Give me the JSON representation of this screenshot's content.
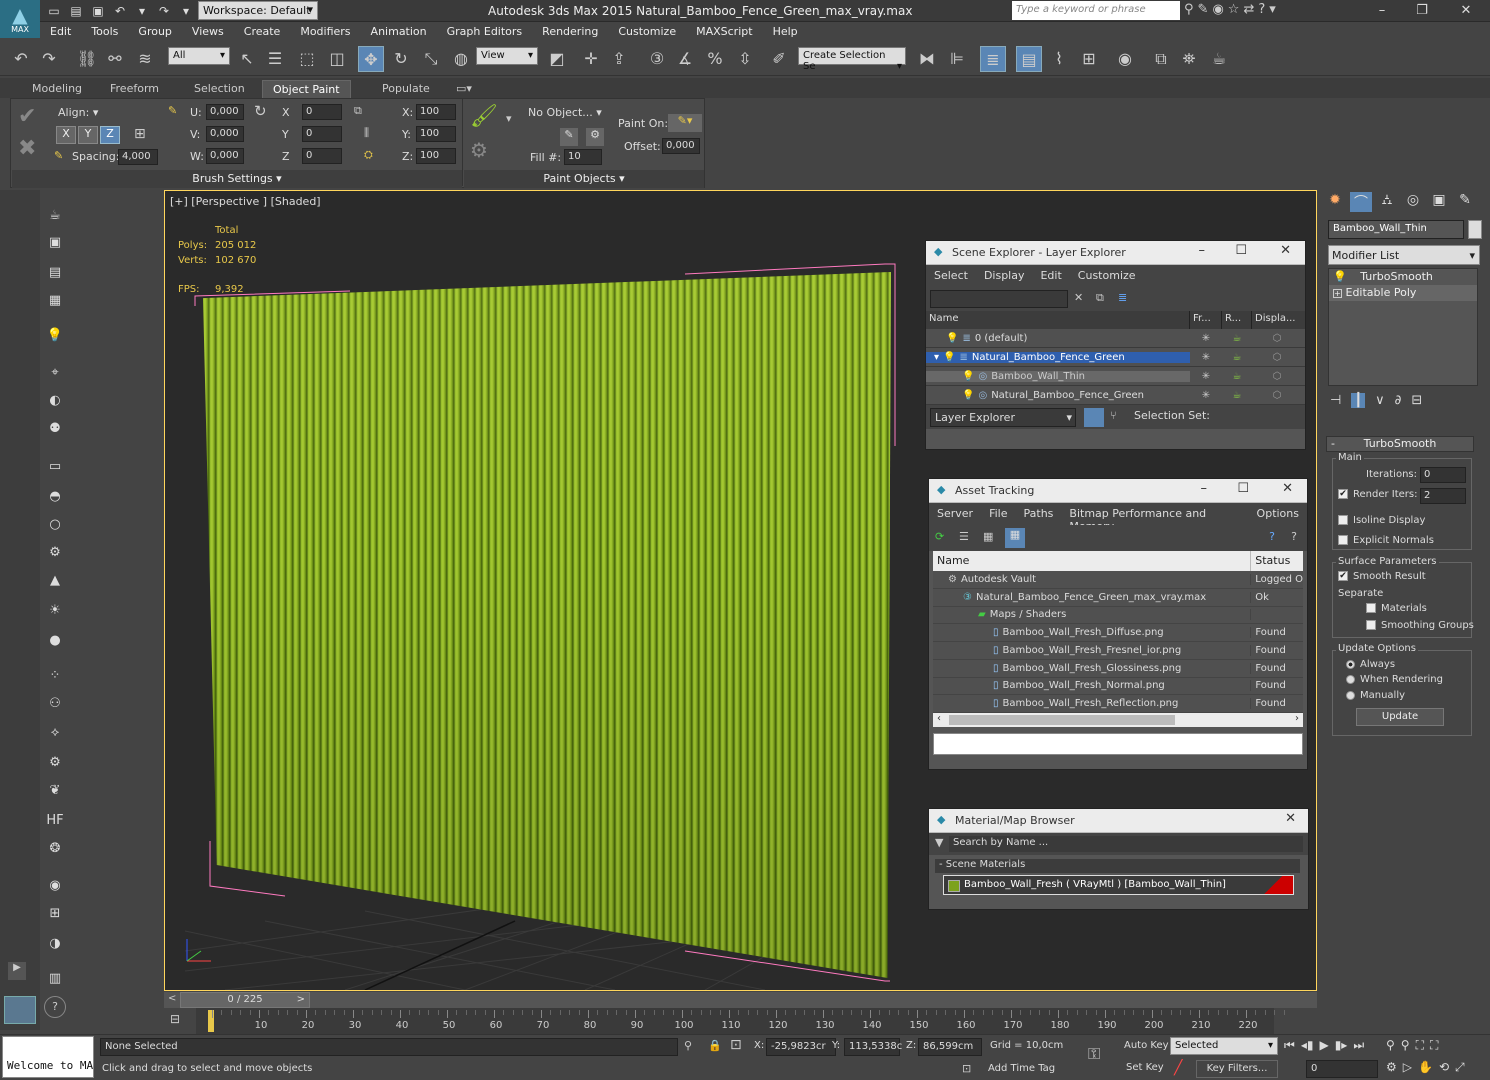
{
  "app": {
    "logo_label": "MAX",
    "workspace": "Workspace: Default",
    "title": "Autodesk 3ds Max  2015    Natural_Bamboo_Fence_Green_max_vray.max",
    "search_placeholder": "Type a keyword or phrase"
  },
  "menu": [
    "Edit",
    "Tools",
    "Group",
    "Views",
    "Create",
    "Modifiers",
    "Animation",
    "Graph Editors",
    "Rendering",
    "Customize",
    "MAXScript",
    "Help"
  ],
  "toolbar": {
    "filter": "All",
    "ref_coord": "View",
    "selection_set": "Create Selection Se"
  },
  "ribbon": {
    "tabs": [
      "Modeling",
      "Freeform",
      "Selection",
      "Object Paint",
      "Populate"
    ],
    "active_tab": "Object Paint",
    "align_label": "Align:",
    "axes": [
      "X",
      "Y",
      "Z"
    ],
    "spacing_label": "Spacing:",
    "spacing_value": "4,000",
    "u_label": "U:",
    "u_value": "0,000",
    "v_label": "V:",
    "v_value": "0,000",
    "w_label": "W:",
    "w_value": "0,000",
    "rx_label": "X",
    "rx_value": "0",
    "ry_label": "Y",
    "ry_value": "0",
    "rz_label": "Z",
    "rz_value": "0",
    "sx_label": "X:",
    "sx_value": "100",
    "sy_label": "Y:",
    "sy_value": "100",
    "sz_label": "Z:",
    "sz_value": "100",
    "brush_settings": "Brush Settings",
    "no_object": "No Object...",
    "paint_on": "Paint On:",
    "offset_label": "Offset:",
    "offset_value": "0,000",
    "fill_label": "Fill #:",
    "fill_value": "10",
    "paint_objects": "Paint Objects"
  },
  "viewport": {
    "label": "[+] [Perspective ] [Shaded]",
    "total_label": "Total",
    "polys_label": "Polys:",
    "polys_value": "205 012",
    "verts_label": "Verts:",
    "verts_value": "102 670",
    "fps_label": "FPS:",
    "fps_value": "9,392"
  },
  "scene_explorer": {
    "title": "Scene Explorer - Layer Explorer",
    "menu": [
      "Select",
      "Display",
      "Edit",
      "Customize"
    ],
    "columns": [
      "Name",
      "Fr...",
      "R...",
      "Displa..."
    ],
    "rows": [
      {
        "name": "0 (default)",
        "indent": 0,
        "selected": false
      },
      {
        "name": "Natural_Bamboo_Fence_Green",
        "indent": 0,
        "selected": true
      },
      {
        "name": "Bamboo_Wall_Thin",
        "indent": 1,
        "selected": false
      },
      {
        "name": "Natural_Bamboo_Fence_Green",
        "indent": 1,
        "selected": false
      }
    ],
    "footer_combo": "Layer Explorer",
    "selection_set": "Selection Set:"
  },
  "asset_tracking": {
    "title": "Asset Tracking",
    "menu": [
      "Server",
      "File",
      "Paths",
      "Bitmap Performance and Memory",
      "Options"
    ],
    "columns": [
      "Name",
      "Status"
    ],
    "rows": [
      {
        "name": "Autodesk Vault",
        "status": "Logged O",
        "indent": 1
      },
      {
        "name": "Natural_Bamboo_Fence_Green_max_vray.max",
        "status": "Ok",
        "indent": 2
      },
      {
        "name": "Maps / Shaders",
        "status": "",
        "indent": 3
      },
      {
        "name": "Bamboo_Wall_Fresh_Diffuse.png",
        "status": "Found",
        "indent": 4
      },
      {
        "name": "Bamboo_Wall_Fresh_Fresnel_ior.png",
        "status": "Found",
        "indent": 4
      },
      {
        "name": "Bamboo_Wall_Fresh_Glossiness.png",
        "status": "Found",
        "indent": 4
      },
      {
        "name": "Bamboo_Wall_Fresh_Normal.png",
        "status": "Found",
        "indent": 4
      },
      {
        "name": "Bamboo_Wall_Fresh_Reflection.png",
        "status": "Found",
        "indent": 4
      }
    ]
  },
  "material_browser": {
    "title": "Material/Map Browser",
    "search_placeholder": "Search by Name ...",
    "group": "- Scene Materials",
    "material": "Bamboo_Wall_Fresh  ( VRayMtl )  [Bamboo_Wall_Thin]"
  },
  "command_panel": {
    "object_name": "Bamboo_Wall_Thin",
    "modifier_list": "Modifier List",
    "stack": [
      "TurboSmooth",
      "Editable Poly"
    ],
    "rollout_title": "TurboSmooth",
    "main_label": "Main",
    "iterations_label": "Iterations:",
    "iterations_value": "0",
    "render_iters_label": "Render Iters:",
    "render_iters_value": "2",
    "isoline": "Isoline Display",
    "explicit_normals": "Explicit Normals",
    "surface_params": "Surface Parameters",
    "smooth_result": "Smooth Result",
    "separate": "Separate",
    "materials": "Materials",
    "smoothing_groups": "Smoothing Groups",
    "update_options": "Update Options",
    "always": "Always",
    "when_rendering": "When Rendering",
    "manually": "Manually",
    "update_button": "Update"
  },
  "timeline": {
    "frame": "0 / 225",
    "ticks": [
      "0",
      "10",
      "20",
      "30",
      "40",
      "50",
      "60",
      "70",
      "80",
      "90",
      "100",
      "110",
      "120",
      "130",
      "140",
      "150",
      "160",
      "170",
      "180",
      "190",
      "200",
      "210",
      "220"
    ]
  },
  "status": {
    "welcome": "Welcome to MA",
    "selection": "None Selected",
    "prompt": "Click and drag to select and move objects",
    "x_label": "X:",
    "x_value": "-25,9823cr",
    "y_label": "Y:",
    "y_value": "113,5338c",
    "z_label": "Z:",
    "z_value": "86,599cm",
    "grid": "Grid = 10,0cm",
    "add_time_tag": "Add Time Tag",
    "auto_key": "Auto Key",
    "selected": "Selected",
    "set_key": "Set Key",
    "key_filters": "Key Filters...",
    "frame_value": "0"
  }
}
